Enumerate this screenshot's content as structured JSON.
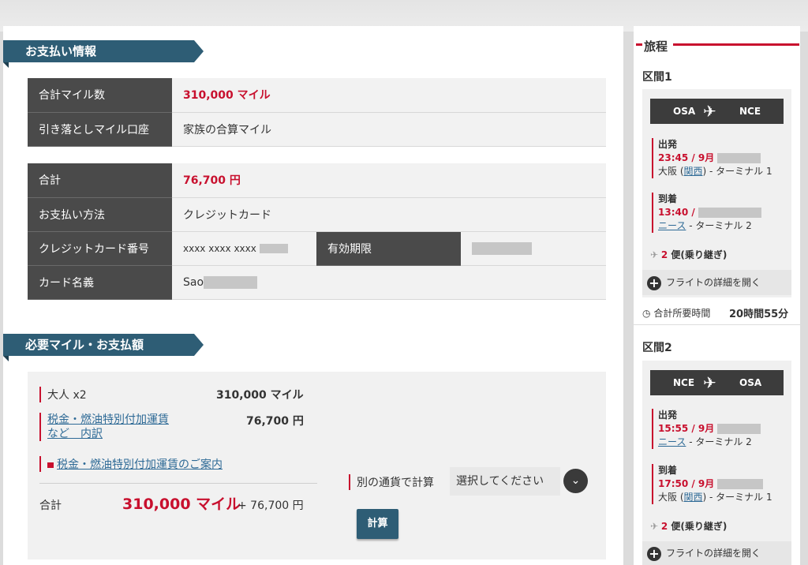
{
  "payment": {
    "title": "お支払い情報",
    "rows1": [
      {
        "label": "合計マイル数",
        "value": "310,000 マイル"
      },
      {
        "label": "引き落としマイル口座",
        "value": "家族の合算マイル"
      }
    ],
    "rows2": [
      {
        "label": "合計",
        "value": "76,700 円"
      },
      {
        "label": "お支払い方法",
        "value": "クレジットカード"
      },
      {
        "label": "クレジットカード番号",
        "value": "xxxx xxxx xxxx"
      },
      {
        "label": "カード名義",
        "value": "Sao"
      }
    ],
    "expiry_label": "有効期限"
  },
  "required": {
    "title": "必要マイル・お支払額",
    "adult_label": "大人 x2",
    "adult_value": "310,000 マイル",
    "tax_link_line1": "税金・燃油特別付加運賃",
    "tax_link_line2": "など　内訳",
    "tax_value": "76,700 円",
    "guide_link": "税金・燃油特別付加運賃のご案内",
    "total_label": "合計",
    "total_miles": "310,000 マイル",
    "total_plus": "+ 76,700 円",
    "currency_label": "別の通貨で計算",
    "select_placeholder": "選択してください",
    "calc_button": "計算"
  },
  "itinerary": {
    "title": "旅程",
    "seg1": {
      "label": "区間1",
      "from": "OSA",
      "to": "NCE",
      "dep_label": "出発",
      "dep_time": "23:45 / 9月",
      "dep_city": "大阪 (",
      "dep_airport": "関西",
      "dep_term": ") - ターミナル 1",
      "arr_label": "到着",
      "arr_time": "13:40 /",
      "arr_airport": "ニース",
      "arr_term": " - ターミナル 2",
      "stops_num": "2",
      "stops_text": " 便(乗り継ぎ)",
      "detail": "フライトの詳細を開く",
      "duration_label": "合計所要時間",
      "duration": "20時間55分"
    },
    "seg2": {
      "label": "区間2",
      "from": "NCE",
      "to": "OSA",
      "dep_label": "出発",
      "dep_time": "15:55 / 9月",
      "dep_airport": "ニース",
      "dep_term": " - ターミナル 2",
      "arr_label": "到着",
      "arr_time": "17:50 / 9月",
      "arr_city": "大阪 (",
      "arr_airport": "関西",
      "arr_term": ") - ターミナル 1",
      "stops_num": "2",
      "stops_text": " 便(乗り継ぎ)",
      "detail": "フライトの詳細を開く"
    }
  },
  "colors": {
    "accent": "#c8102e",
    "ribbon": "#2e5d75",
    "header_cell": "#4a4a4a"
  }
}
